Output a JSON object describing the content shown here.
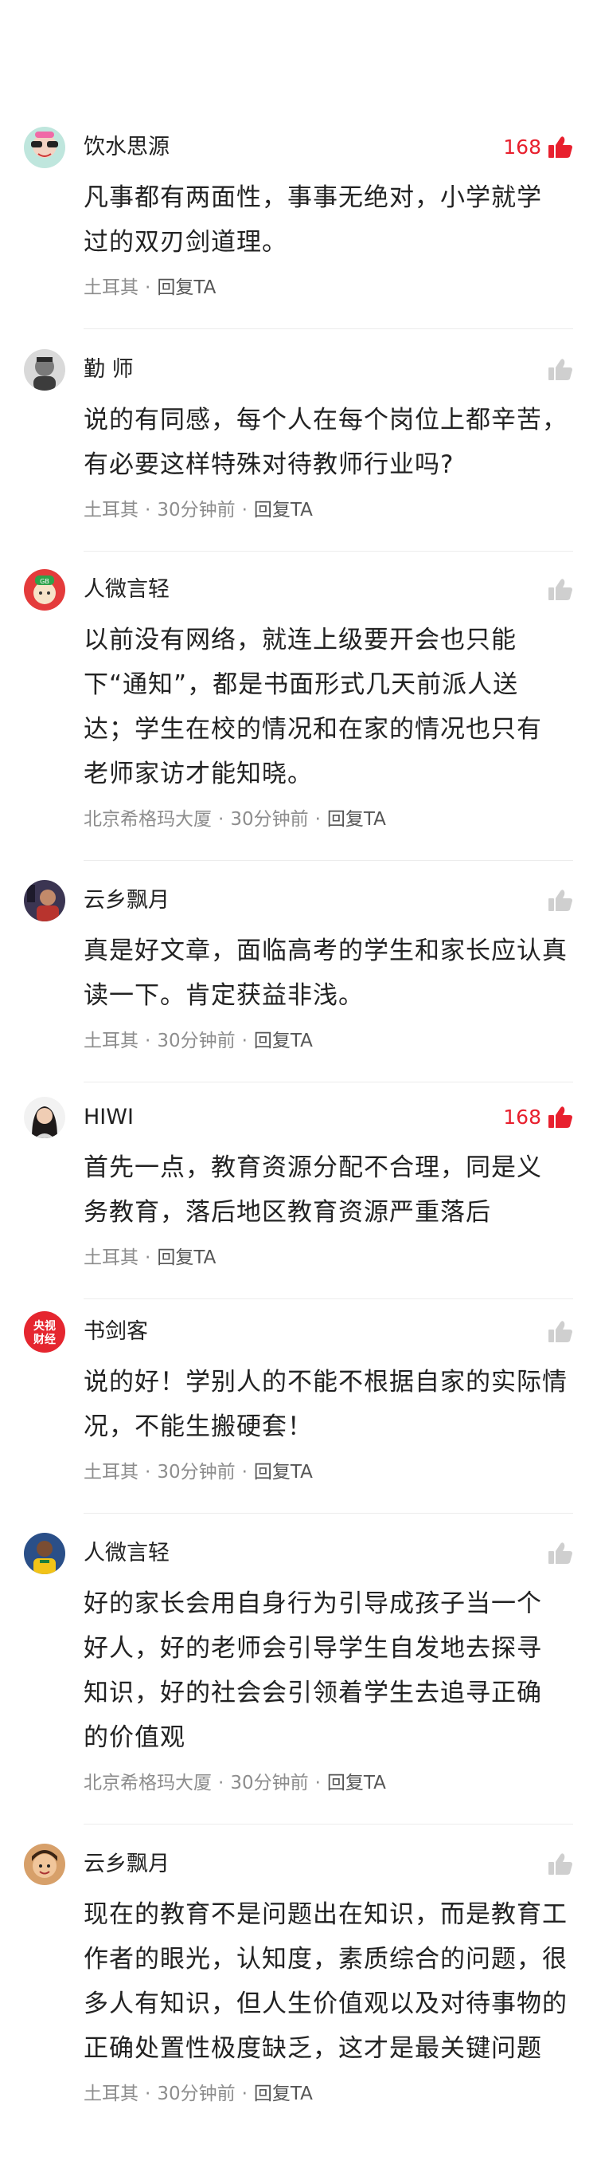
{
  "comments": [
    {
      "user": "饮水思源",
      "likes": "168",
      "liked": true,
      "lines": [
        "凡事都有两面性，事事无绝对，小学就学",
        "过的双刃剑道理。"
      ],
      "source": "土耳其",
      "time": "",
      "reply": "回复TA",
      "avatar": "avatar-cartoon-icon"
    },
    {
      "user": "勤 师",
      "likes": "",
      "liked": false,
      "lines": [
        "说的有同感，每个人在每个岗位上都辛苦，",
        "有必要这样特殊对待教师行业吗?"
      ],
      "source": "土耳其",
      "time": "30分钟前",
      "reply": "回复TA",
      "avatar": "avatar-portrait-icon"
    },
    {
      "user": "人微言轻",
      "likes": "",
      "liked": false,
      "lines": [
        "以前没有网络，就连上级要开会也只能",
        "下“通知”，都是书面形式几天前派人送",
        "达；学生在校的情况和在家的情况也只有",
        "老师家访才能知晓。"
      ],
      "source": "北京希格玛大厦",
      "time": "30分钟前",
      "reply": "回复TA",
      "avatar": "avatar-cartoon-cap-icon"
    },
    {
      "user": "云乡飘月",
      "likes": "",
      "liked": false,
      "lines": [
        "真是好文章，面临高考的学生和家长应认真",
        "读一下。肯定获益非浅。"
      ],
      "source": "土耳其",
      "time": "30分钟前",
      "reply": "回复TA",
      "avatar": "avatar-photo-icon"
    },
    {
      "user": "HIWI",
      "likes": "168",
      "liked": true,
      "lines": [
        "首先一点，教育资源分配不合理，同是义",
        "务教育，落后地区教育资源严重落后"
      ],
      "source": "土耳其",
      "time": "",
      "reply": "回复TA",
      "avatar": "avatar-woman-icon"
    },
    {
      "user": "书剑客",
      "likes": "",
      "liked": false,
      "lines": [
        "说的好！学别人的不能不根据自家的实际情",
        "况，不能生搬硬套！"
      ],
      "source": "土耳其",
      "time": "30分钟前",
      "reply": "回复TA",
      "avatar": "avatar-logo-icon",
      "avatar_text": [
        "央视",
        "财经"
      ]
    },
    {
      "user": "人微言轻",
      "likes": "",
      "liked": false,
      "lines": [
        "好的家长会用自身行为引导成孩子当一个",
        "好人，好的老师会引导学生自发地去探寻",
        "知识，好的社会会引领着学生去追寻正确",
        "的价值观"
      ],
      "source": "北京希格玛大厦",
      "time": "30分钟前",
      "reply": "回复TA",
      "avatar": "avatar-athlete-icon"
    },
    {
      "user": "云乡飘月",
      "likes": "",
      "liked": false,
      "lines": [
        "现在的教育不是问题出在知识，而是教育工",
        "作者的眼光，认知度，素质综合的问题，很",
        "多人有知识，但人生价值观以及对待事物的",
        "正确处置性极度缺乏，这才是最关键问题"
      ],
      "source": "土耳其",
      "time": "30分钟前",
      "reply": "回复TA",
      "avatar": "avatar-child-icon"
    }
  ],
  "colors": {
    "accent": "#e8202e",
    "like_inactive": "#cfcfcf",
    "meta": "#8d8d8d"
  }
}
